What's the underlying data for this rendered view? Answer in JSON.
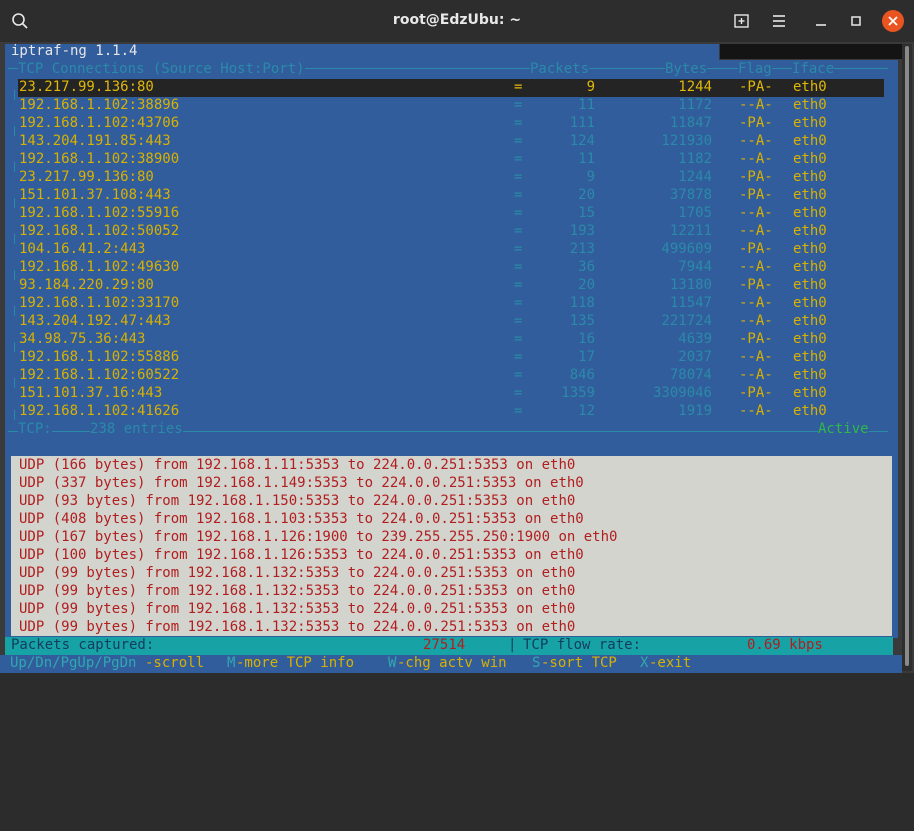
{
  "window": {
    "title": "root@EdzUbu: ~",
    "icons": [
      "search-icon",
      "new-tab-icon",
      "hamburger-menu-icon",
      "minimize-icon",
      "maximize-icon",
      "close-icon"
    ]
  },
  "app": {
    "title": "iptraf-ng 1.1.4"
  },
  "tcp": {
    "headers": {
      "connections": "TCP Connections (Source Host:Port)",
      "packets": "Packets",
      "bytes": "Bytes",
      "flag": "Flag",
      "iface": "Iface"
    },
    "rows": [
      {
        "addr": "23.217.99.136:80",
        "eq": "=",
        "packets": "9",
        "bytes": "1244",
        "flag": "-PA-",
        "iface": "eth0"
      },
      {
        "addr": "192.168.1.102:38896",
        "eq": "=",
        "packets": "11",
        "bytes": "1172",
        "flag": "--A-",
        "iface": "eth0"
      },
      {
        "addr": "192.168.1.102:43706",
        "eq": "=",
        "packets": "111",
        "bytes": "11847",
        "flag": "-PA-",
        "iface": "eth0"
      },
      {
        "addr": "143.204.191.85:443",
        "eq": "=",
        "packets": "124",
        "bytes": "121930",
        "flag": "--A-",
        "iface": "eth0"
      },
      {
        "addr": "192.168.1.102:38900",
        "eq": "=",
        "packets": "11",
        "bytes": "1182",
        "flag": "--A-",
        "iface": "eth0"
      },
      {
        "addr": "23.217.99.136:80",
        "eq": "=",
        "packets": "9",
        "bytes": "1244",
        "flag": "-PA-",
        "iface": "eth0"
      },
      {
        "addr": "151.101.37.108:443",
        "eq": "=",
        "packets": "20",
        "bytes": "37878",
        "flag": "-PA-",
        "iface": "eth0"
      },
      {
        "addr": "192.168.1.102:55916",
        "eq": "=",
        "packets": "15",
        "bytes": "1705",
        "flag": "--A-",
        "iface": "eth0"
      },
      {
        "addr": "192.168.1.102:50052",
        "eq": "=",
        "packets": "193",
        "bytes": "12211",
        "flag": "--A-",
        "iface": "eth0"
      },
      {
        "addr": "104.16.41.2:443",
        "eq": "=",
        "packets": "213",
        "bytes": "499609",
        "flag": "-PA-",
        "iface": "eth0"
      },
      {
        "addr": "192.168.1.102:49630",
        "eq": "=",
        "packets": "36",
        "bytes": "7944",
        "flag": "--A-",
        "iface": "eth0"
      },
      {
        "addr": "93.184.220.29:80",
        "eq": "=",
        "packets": "20",
        "bytes": "13180",
        "flag": "-PA-",
        "iface": "eth0"
      },
      {
        "addr": "192.168.1.102:33170",
        "eq": "=",
        "packets": "118",
        "bytes": "11547",
        "flag": "--A-",
        "iface": "eth0"
      },
      {
        "addr": "143.204.192.47:443",
        "eq": "=",
        "packets": "135",
        "bytes": "221724",
        "flag": "--A-",
        "iface": "eth0"
      },
      {
        "addr": "34.98.75.36:443",
        "eq": "=",
        "packets": "16",
        "bytes": "4639",
        "flag": "-PA-",
        "iface": "eth0"
      },
      {
        "addr": "192.168.1.102:55886",
        "eq": "=",
        "packets": "17",
        "bytes": "2037",
        "flag": "--A-",
        "iface": "eth0"
      },
      {
        "addr": "192.168.1.102:60522",
        "eq": "=",
        "packets": "846",
        "bytes": "78074",
        "flag": "--A-",
        "iface": "eth0"
      },
      {
        "addr": "151.101.37.16:443",
        "eq": "=",
        "packets": "1359",
        "bytes": "3309046",
        "flag": "-PA-",
        "iface": "eth0"
      },
      {
        "addr": "192.168.1.102:41626",
        "eq": "=",
        "packets": "12",
        "bytes": "1919",
        "flag": "--A-",
        "iface": "eth0"
      }
    ],
    "summary_label": "TCP:",
    "summary_entries": "238 entries",
    "state": "Active"
  },
  "udp": {
    "lines": [
      "UDP (166 bytes) from 192.168.1.11:5353 to 224.0.0.251:5353 on eth0",
      "UDP (337 bytes) from 192.168.1.149:5353 to 224.0.0.251:5353 on eth0",
      "UDP (93 bytes) from 192.168.1.150:5353 to 224.0.0.251:5353 on eth0",
      "UDP (408 bytes) from 192.168.1.103:5353 to 224.0.0.251:5353 on eth0",
      "UDP (167 bytes) from 192.168.1.126:1900 to 239.255.255.250:1900 on eth0",
      "UDP (100 bytes) from 192.168.1.126:5353 to 224.0.0.251:5353 on eth0",
      "UDP (99 bytes) from 192.168.1.132:5353 to 224.0.0.251:5353 on eth0",
      "UDP (99 bytes) from 192.168.1.132:5353 to 224.0.0.251:5353 on eth0",
      "UDP (99 bytes) from 192.168.1.132:5353 to 224.0.0.251:5353 on eth0",
      "UDP (99 bytes) from 192.168.1.132:5353 to 224.0.0.251:5353 on eth0"
    ]
  },
  "status": {
    "packets_label": "Packets captured:",
    "packets_value": "27514",
    "separator": "|",
    "flow_label": "TCP flow rate:",
    "flow_value": "0.69 kbps"
  },
  "footer": {
    "k1": "Up/Dn/PgUp/PgDn",
    "d1": "-scroll",
    "k2": "M",
    "d2": "-more TCP info",
    "k3": "W",
    "d3": "-chg actv win",
    "k4": "S",
    "d4": "-sort TCP",
    "k5": "X",
    "d5": "-exit"
  },
  "colors": {
    "panel_blue": "#325d9c",
    "yellow": "#d8b100",
    "cyan": "#2a8aa8",
    "udp_red": "#b01e1e",
    "status_teal": "#17a3a6",
    "close_orange": "#e95420"
  }
}
